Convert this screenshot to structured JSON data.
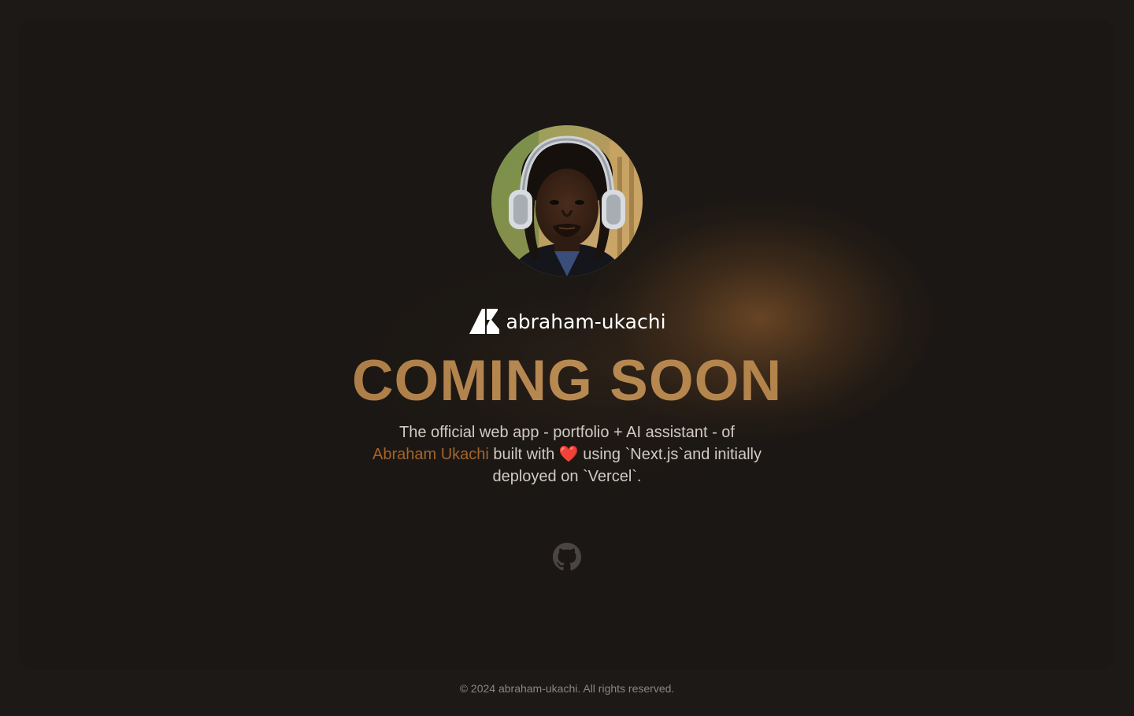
{
  "brand": {
    "name": "abraham-ukachi",
    "logo": "brand-logo-icon"
  },
  "avatar": {
    "alt": "Abraham Ukachi wearing headphones"
  },
  "hero": {
    "headline": "COMING SOON",
    "description": {
      "part1": "The official web app - portfolio + AI assistant - of",
      "name": "Abraham Ukachi",
      "part2": "built with",
      "heart": "❤️",
      "part3": "using `Next.js`and initially deployed on `Vercel`."
    }
  },
  "social": {
    "github_icon": "github-icon"
  },
  "footer": {
    "copyright": "© 2024 abraham-ukachi. All rights reserved."
  },
  "colors": {
    "background": "#1d1916",
    "accent": "#b3814a",
    "link": "#a4652b",
    "text": "#d2cbc4",
    "muted": "#8b8682"
  }
}
